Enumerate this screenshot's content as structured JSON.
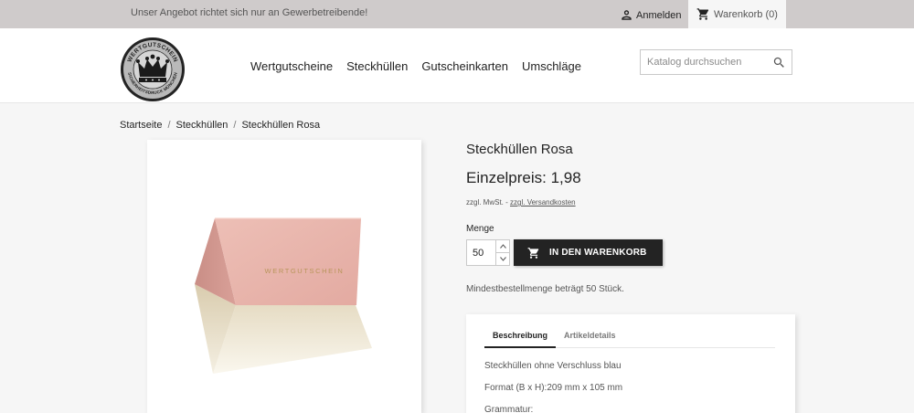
{
  "topbar": {
    "notice": "Unser Angebot richtet sich nur an Gewerbetreibende!",
    "login_label": "Anmelden",
    "cart_label": "Warenkorb (0)"
  },
  "logo": {
    "text_top": "WERTGUTSCHEIN",
    "text_bottom": "SICHERHEITSDRUCK MÜNCHEN"
  },
  "nav": {
    "items": [
      "Wertgutscheine",
      "Steckhüllen",
      "Gutscheinkarten",
      "Umschläge"
    ]
  },
  "search": {
    "placeholder": "Katalog durchsuchen",
    "icon": "search-icon"
  },
  "breadcrumb": [
    "Startseite",
    "Steckhüllen",
    "Steckhüllen Rosa"
  ],
  "product": {
    "title": "Steckhüllen Rosa",
    "price": "Einzelpreis: 1,98",
    "tax_note": "zzgl. MwSt. -",
    "shipping_link": "zzgl. Versandkosten",
    "image_text": "WERTGUTSCHEIN",
    "envelope_color": "#e8b6ad",
    "quantity_label": "Menge",
    "quantity_value": "50",
    "add_to_cart": "IN DEN WARENKORB",
    "min_order": "Mindestbestellmenge beträgt 50 Stück."
  },
  "tabs": {
    "items": [
      "Beschreibung",
      "Artikeldetails"
    ],
    "active": "Beschreibung"
  },
  "description": {
    "line1": "Steckhüllen ohne Verschluss blau",
    "line2": "Format (B x H):209 mm x 105 mm",
    "line3": "Grammatur:"
  }
}
